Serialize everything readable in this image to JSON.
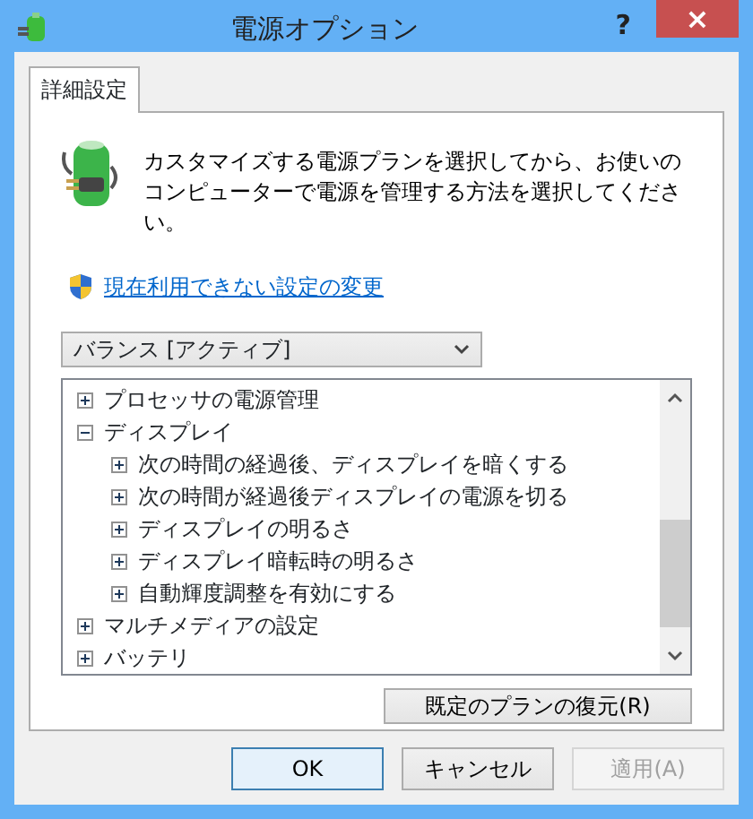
{
  "window": {
    "title": "電源オプション",
    "help": "?",
    "close": "×"
  },
  "tabs": [
    {
      "label": "詳細設定",
      "selected": true
    }
  ],
  "description": "カスタマイズする電源プランを選択してから、お使いのコンピューターで電源を管理する方法を選択してください。",
  "link": "現在利用できない設定の変更",
  "plan_select": {
    "value": "バランス [アクティブ]"
  },
  "tree": [
    {
      "label": "プロセッサの電源管理",
      "expanded": false
    },
    {
      "label": "ディスプレイ",
      "expanded": true,
      "children": [
        {
          "label": "次の時間の経過後、ディスプレイを暗くする",
          "expanded": false
        },
        {
          "label": "次の時間が経過後ディスプレイの電源を切る",
          "expanded": false
        },
        {
          "label": "ディスプレイの明るさ",
          "expanded": false
        },
        {
          "label": "ディスプレイ暗転時の明るさ",
          "expanded": false
        },
        {
          "label": "自動輝度調整を有効にする",
          "expanded": false
        }
      ]
    },
    {
      "label": "マルチメディアの設定",
      "expanded": false
    },
    {
      "label": "バッテリ",
      "expanded": false
    }
  ],
  "restore_button": "既定のプランの復元(R)",
  "buttons": [
    {
      "label": "OK",
      "kind": "default",
      "disabled": false
    },
    {
      "label": "キャンセル",
      "kind": "normal",
      "disabled": false
    },
    {
      "label": "適用(A)",
      "kind": "normal",
      "disabled": true
    }
  ]
}
